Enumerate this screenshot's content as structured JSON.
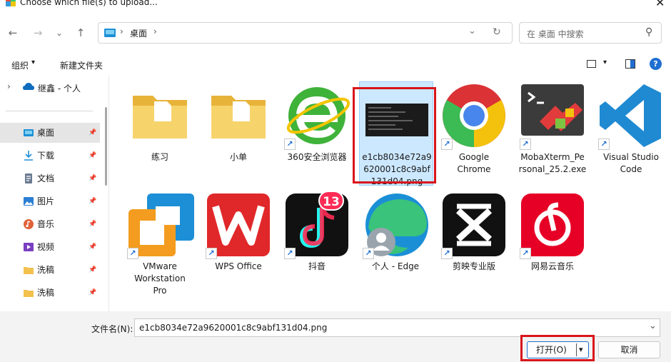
{
  "window": {
    "title": "Choose which file(s) to upload...",
    "close_glyph": "✕"
  },
  "nav": {
    "back": "←",
    "forward": "→",
    "dropdown": "⌄",
    "up": "↑"
  },
  "address": {
    "location": "桌面",
    "sep1": "›",
    "sep2": "›",
    "dropdown": "⌄",
    "refresh": "↻"
  },
  "search": {
    "placeholder": "在 桌面 中搜索",
    "icon": "⚲"
  },
  "toolbar": {
    "organize": "组织",
    "organize_arrow": "▾",
    "new_folder": "新建文件夹",
    "view_arrow": "▾",
    "help": "?"
  },
  "sidebar": {
    "top_item": {
      "chevron": "›",
      "label": "继鑫 - 个人"
    },
    "items": [
      {
        "label": "桌面",
        "icon": "desktop-icon",
        "color": "#1e90d6"
      },
      {
        "label": "下载",
        "icon": "download-icon",
        "color": "#1e90d6"
      },
      {
        "label": "文档",
        "icon": "document-icon",
        "color": "#6a7b92"
      },
      {
        "label": "图片",
        "icon": "pictures-icon",
        "color": "#2a7fd4"
      },
      {
        "label": "音乐",
        "icon": "music-icon",
        "color": "#e0623a"
      },
      {
        "label": "视频",
        "icon": "video-icon",
        "color": "#7a3fc1"
      },
      {
        "label": "洗稿",
        "icon": "folder-icon",
        "color": "#f2c14e"
      },
      {
        "label": "洗稿",
        "icon": "folder-icon",
        "color": "#f2c14e"
      }
    ],
    "pin": "📌"
  },
  "files": [
    {
      "name": "练习"
    },
    {
      "name": "小单"
    },
    {
      "name": "360安全浏览器"
    },
    {
      "name_lines": [
        "e1cb8034e72a9",
        "620001c8c9abf",
        "131d04.png"
      ]
    },
    {
      "name_lines": [
        "Google",
        "Chrome"
      ]
    },
    {
      "name_lines": [
        "MobaXterm_Pe",
        "rsonal_25.2.exe"
      ]
    },
    {
      "name_lines": [
        "Visual Studio",
        "Code"
      ]
    },
    {
      "name_lines": [
        "VMware",
        "Workstation",
        "Pro"
      ]
    },
    {
      "name": "WPS Office"
    },
    {
      "name": "抖音",
      "badge": "13"
    },
    {
      "name": "个人 - Edge"
    },
    {
      "name": "剪映专业版"
    },
    {
      "name": "网易云音乐"
    }
  ],
  "bottom": {
    "filename_label": "文件名(N):",
    "filename_value": "e1cb8034e72a9620001c8c9abf131d04.png",
    "dropdown": "⌄",
    "open_label": "打开(O)",
    "open_arrow": "▾",
    "cancel_label": "取消"
  },
  "colors": {
    "selection": "#cce8ff",
    "highlight_red": "#d9141b",
    "accent": "#1f6fd1"
  }
}
